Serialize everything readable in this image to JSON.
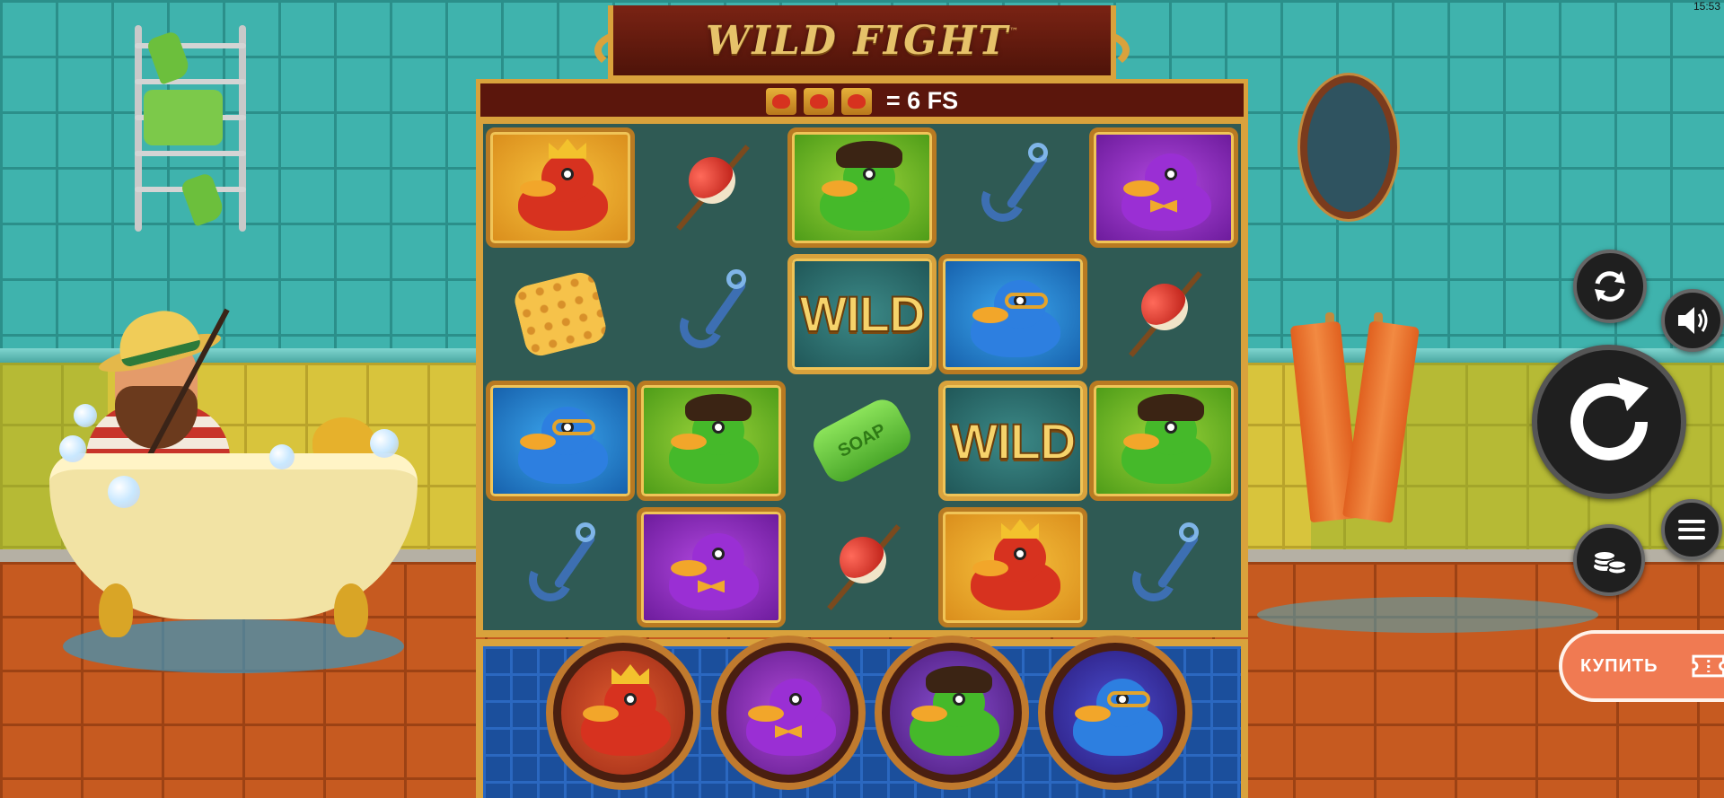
{
  "status": {
    "time": "15:53"
  },
  "game": {
    "title": "WILD FIGHT",
    "trademark": "™",
    "feature_banner": {
      "icons": [
        "duck-scatter-icon",
        "duck-scatter-icon",
        "duck-scatter-icon"
      ],
      "text": "= 6 FS"
    }
  },
  "reels": {
    "columns": 5,
    "rows": 4,
    "symbols": [
      [
        "red-crown-duck",
        "float",
        "green-pirate-duck",
        "hook",
        "purple-bowtie-duck"
      ],
      [
        "sponge",
        "hook",
        "wild",
        "blue-goggles-duck",
        "float"
      ],
      [
        "blue-goggles-duck",
        "green-pirate-duck",
        "soap",
        "wild",
        "green-pirate-duck"
      ],
      [
        "hook",
        "purple-bowtie-duck",
        "float",
        "red-crown-duck",
        "hook"
      ]
    ],
    "wild_label": "WILD",
    "soap_label": "SOAP"
  },
  "fighters": [
    {
      "name": "red-crown-duck"
    },
    {
      "name": "purple-bowtie-duck"
    },
    {
      "name": "green-pirate-duck"
    },
    {
      "name": "blue-goggles-duck"
    }
  ],
  "controls": {
    "autoplay_icon": "autoplay-icon",
    "sound_icon": "sound-icon",
    "spin_icon": "spin-icon",
    "menu_icon": "menu-icon",
    "bet_icon": "coins-icon",
    "buy_label": "КУПИТЬ",
    "buy_icon": "ticket-icon"
  },
  "colors": {
    "frame_gold": "#d9a23c",
    "title_red": "#5b160c",
    "buy_orange": "#f07a52"
  }
}
